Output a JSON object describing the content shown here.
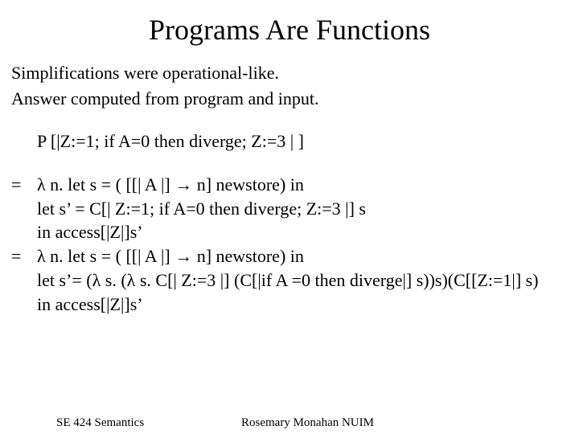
{
  "title": "Programs Are Functions",
  "p1": "Simplifications were operational-like.",
  "p2": "Answer computed from program and input.",
  "expr1": "P [|Z:=1; if A=0 then diverge; Z:=3 | ]",
  "eq1_mark": "=",
  "eq1_l1": "λ n. let s = ( [[| A |] →  n] newstore) in",
  "eq1_l2": "let s’ = C[| Z:=1; if A=0 then diverge; Z:=3 |] s",
  "eq1_l3": "in access[|Z|]s’",
  "eq2_mark": "=",
  "eq2_l1": "λ n. let s = ( [[| A |] →  n] newstore) in",
  "eq2_l2": "let s’= (λ s. (λ s. C[| Z:=3 |] (C[|if A =0 then diverge|] s))s)(C[[Z:=1|] s)",
  "eq2_l3": "in access[|Z|]s’",
  "footer_left": "SE 424 Semantics",
  "footer_center": "Rosemary Monahan NUIM"
}
